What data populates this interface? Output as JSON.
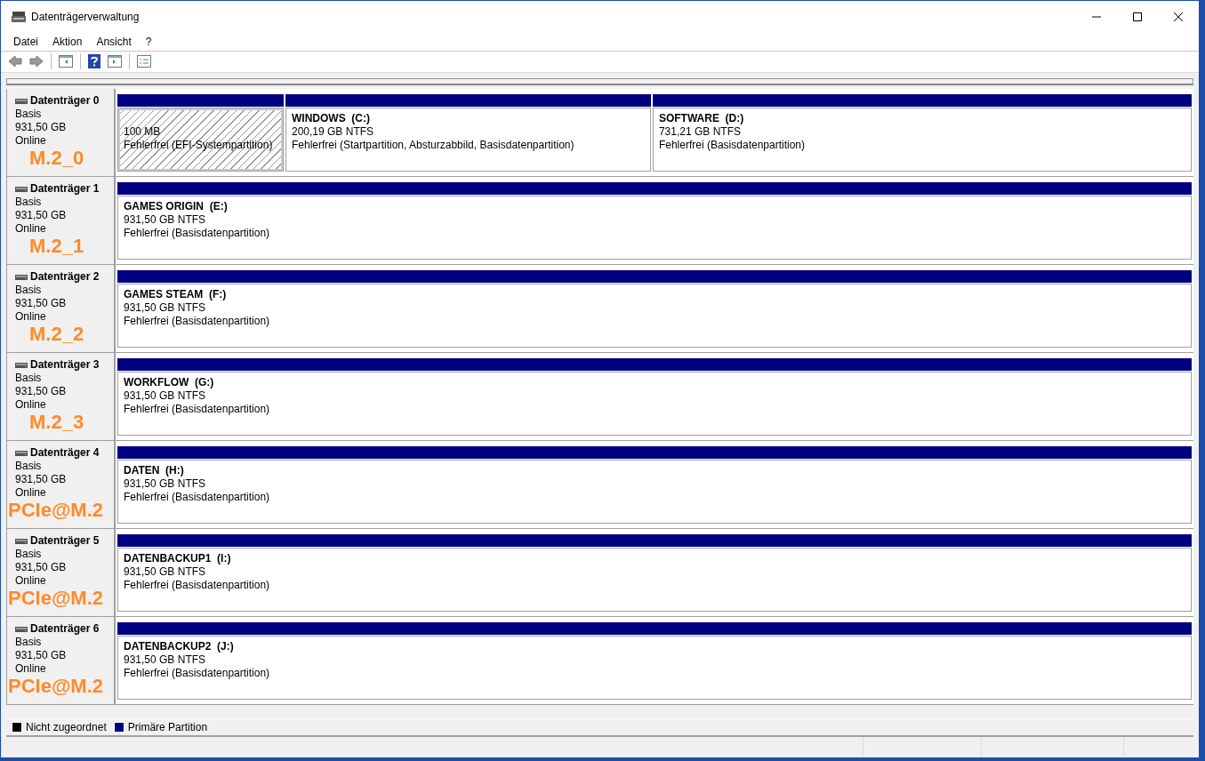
{
  "window": {
    "title": "Datenträgerverwaltung"
  },
  "menu": [
    "Datei",
    "Aktion",
    "Ansicht",
    "?"
  ],
  "disks": [
    {
      "title": "Datenträger 0",
      "type": "Basis",
      "size": "931,50 GB",
      "status": "Online",
      "annotation": "M.2_0",
      "partitions": [
        {
          "kind": "efi",
          "size": "100 MB",
          "status": "Fehlerfrei (EFI-Systempartition)"
        },
        {
          "kind": "primary",
          "name": "WINDOWS  (C:)",
          "size": "200,19 GB NTFS",
          "status": "Fehlerfrei (Startpartition, Absturzabbild, Basisdatenpartition)"
        },
        {
          "kind": "primary",
          "name": "SOFTWARE  (D:)",
          "size": "731,21 GB NTFS",
          "status": "Fehlerfrei (Basisdatenpartition)"
        }
      ]
    },
    {
      "title": "Datenträger 1",
      "type": "Basis",
      "size": "931,50 GB",
      "status": "Online",
      "annotation": "M.2_1",
      "partitions": [
        {
          "kind": "primary",
          "name": "GAMES ORIGIN  (E:)",
          "size": "931,50 GB NTFS",
          "status": "Fehlerfrei (Basisdatenpartition)"
        }
      ]
    },
    {
      "title": "Datenträger 2",
      "type": "Basis",
      "size": "931,50 GB",
      "status": "Online",
      "annotation": "M.2_2",
      "partitions": [
        {
          "kind": "primary",
          "name": "GAMES STEAM  (F:)",
          "size": "931,50 GB NTFS",
          "status": "Fehlerfrei (Basisdatenpartition)"
        }
      ]
    },
    {
      "title": "Datenträger 3",
      "type": "Basis",
      "size": "931,50 GB",
      "status": "Online",
      "annotation": "M.2_3",
      "partitions": [
        {
          "kind": "primary",
          "name": "WORKFLOW  (G:)",
          "size": "931,50 GB NTFS",
          "status": "Fehlerfrei (Basisdatenpartition)"
        }
      ]
    },
    {
      "title": "Datenträger 4",
      "type": "Basis",
      "size": "931,50 GB",
      "status": "Online",
      "annotation": "PCIe@M.2",
      "partitions": [
        {
          "kind": "primary",
          "name": "DATEN  (H:)",
          "size": "931,50 GB NTFS",
          "status": "Fehlerfrei (Basisdatenpartition)"
        }
      ]
    },
    {
      "title": "Datenträger 5",
      "type": "Basis",
      "size": "931,50 GB",
      "status": "Online",
      "annotation": "PCIe@M.2",
      "partitions": [
        {
          "kind": "primary",
          "name": "DATENBACKUP1  (I:)",
          "size": "931,50 GB NTFS",
          "status": "Fehlerfrei (Basisdatenpartition)"
        }
      ]
    },
    {
      "title": "Datenträger 6",
      "type": "Basis",
      "size": "931,50 GB",
      "status": "Online",
      "annotation": "PCIe@M.2",
      "partitions": [
        {
          "kind": "primary",
          "name": "DATENBACKUP2  (J:)",
          "size": "931,50 GB NTFS",
          "status": "Fehlerfrei (Basisdatenpartition)"
        }
      ]
    }
  ],
  "legend": [
    {
      "label": "Nicht zugeordnet",
      "color": "#000000"
    },
    {
      "label": "Primäre Partition",
      "color": "#000080"
    }
  ]
}
